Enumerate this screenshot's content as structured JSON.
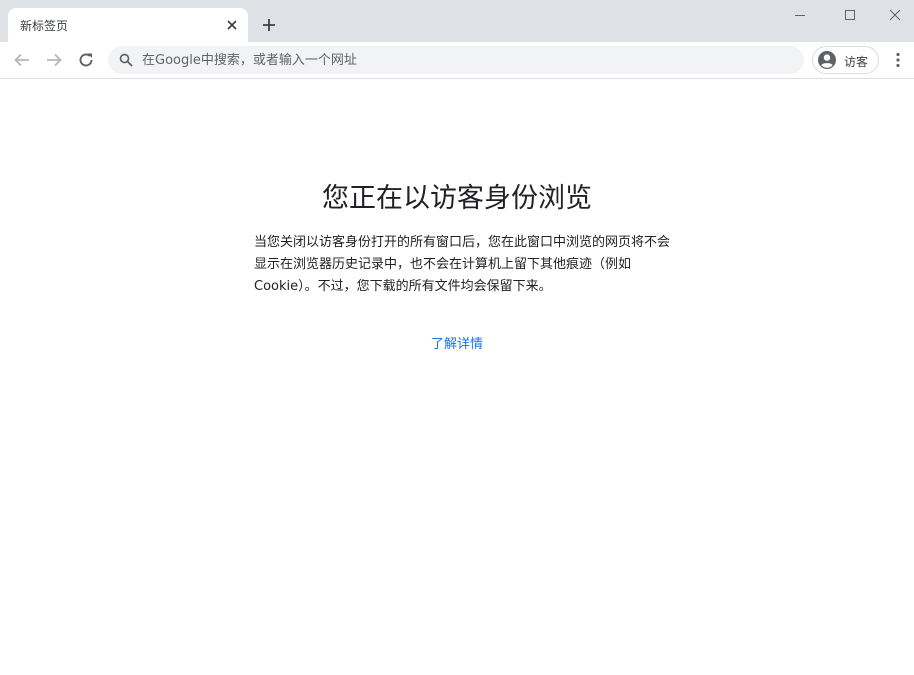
{
  "tab": {
    "title": "新标签页"
  },
  "omnibox": {
    "placeholder": "在Google中搜索，或者输入一个网址",
    "value": ""
  },
  "profile": {
    "label": "访客"
  },
  "page": {
    "heading": "您正在以访客身份浏览",
    "description": "当您关闭以访客身份打开的所有窗口后，您在此窗口中浏览的网页将不会显示在浏览器历史记录中，也不会在计算机上留下其他痕迹（例如Cookie）。不过，您下载的所有文件均会保留下来。",
    "learn_more": "了解详情"
  },
  "colors": {
    "tabstrip": "#dee1e6",
    "omnibox": "#f1f3f4",
    "link": "#1a73e8",
    "icon": "#5f6368",
    "icon_disabled": "#b5b8bc"
  },
  "icons": {
    "tab_close": "close-icon",
    "new_tab": "plus-icon",
    "minimize": "minimize-icon",
    "maximize": "maximize-icon",
    "window_close": "close-icon",
    "back": "arrow-left-icon",
    "forward": "arrow-right-icon",
    "reload": "reload-icon",
    "search": "search-icon",
    "avatar": "avatar-icon",
    "menu": "more-vert-icon"
  }
}
